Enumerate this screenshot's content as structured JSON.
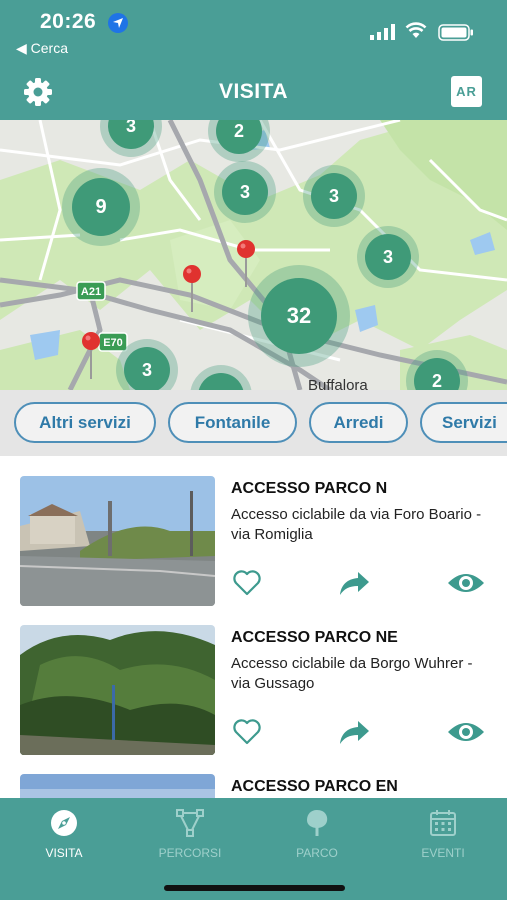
{
  "status_bar": {
    "time": "20:26",
    "back_label": "◀ Cerca"
  },
  "header": {
    "title": "VISITA",
    "ar_label": "AR"
  },
  "map": {
    "clusters": [
      "3",
      "2",
      "9",
      "3",
      "3",
      "3",
      "32",
      "3",
      "2"
    ],
    "road_labels": [
      "A21",
      "E70"
    ],
    "place_label": "Buffalora"
  },
  "filters": [
    "Altri servizi",
    "Fontanile",
    "Arredi",
    "Servizi"
  ],
  "places": [
    {
      "name": "ACCESSO PARCO N",
      "desc": "Accesso ciclabile da via Foro Boario - via Romiglia"
    },
    {
      "name": "ACCESSO PARCO NE",
      "desc": "Accesso ciclabile da Borgo Wuhrer - via Gussago"
    },
    {
      "name": "ACCESSO PARCO EN",
      "desc": ""
    }
  ],
  "tabs": [
    {
      "label": "VISITA",
      "icon": "compass-icon",
      "active": true
    },
    {
      "label": "PERCORSI",
      "icon": "route-icon",
      "active": false
    },
    {
      "label": "PARCO",
      "icon": "tree-icon",
      "active": false
    },
    {
      "label": "EVENTI",
      "icon": "calendar-icon",
      "active": false
    }
  ],
  "colors": {
    "brand": "#4a9e96",
    "chip_border": "#4e8fb8",
    "cluster": "#3f9a78",
    "pin": "#e0322f"
  }
}
